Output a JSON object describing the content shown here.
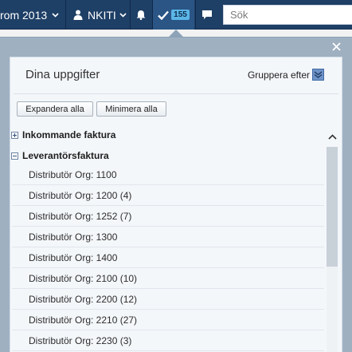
{
  "topbar": {
    "environment_label": "rom 2013",
    "user_label": "NKITI",
    "tasks_count": "155",
    "search_placeholder": "Sök"
  },
  "panel": {
    "title": "Dina uppgifter",
    "group_by_label": "Gruppera efter",
    "expand_all_label": "Expandera alla",
    "collapse_all_label": "Minimera alla",
    "groups": [
      {
        "label": "Inkommande faktura",
        "expanded": false
      },
      {
        "label": "Leverantörsfaktura",
        "expanded": true
      }
    ],
    "items": [
      "Distributör Org: 1100",
      "Distributör Org: 1200 (4)",
      "Distributör Org: 1252 (7)",
      "Distributör Org: 1300",
      "Distributör Org: 1400",
      "Distributör Org: 2100 (10)",
      "Distributör Org: 2200 (12)",
      "Distributör Org: 2210 (27)",
      "Distributör Org: 2230 (3)"
    ]
  },
  "icons": {
    "user": "user-icon",
    "bell": "bell-icon",
    "tasks": "checkmark-icon",
    "chat": "chat-icon",
    "close": "close-icon",
    "group_by": "dropdown-arrow-icon"
  },
  "colors": {
    "topbar_bg": "#1e3f66",
    "panel_bg": "#9fb0c1",
    "badge_bg": "#5bb6e6"
  }
}
